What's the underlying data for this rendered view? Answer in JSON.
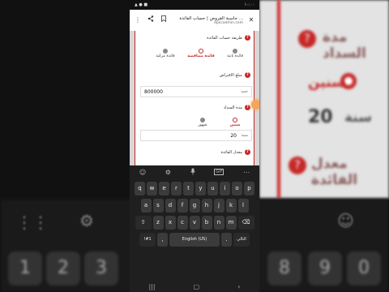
{
  "status": {
    "time": "١٠:٠٠",
    "icons": "▲ ● ■"
  },
  "browser": {
    "close": "✕",
    "title": "حاسبة القروض | حساب الفائدة ...",
    "url": "epiicadmin.com",
    "share_icon": "share-icon",
    "bookmark_icon": "bookmark-icon",
    "menu": "⋮"
  },
  "form": {
    "method_label": "طريقة حساب الفائدة",
    "methods": [
      {
        "label": "فائدة ثابتة",
        "state": "grey"
      },
      {
        "label": "فائدة متناقصة",
        "state": "selected"
      },
      {
        "label": "فائدة مركبة",
        "state": "grey"
      }
    ],
    "amount_label": "مبلغ الاقتراض",
    "amount_value": "800000",
    "amount_unit": "جنيه",
    "period_label": "مدة السداد",
    "period_options": [
      {
        "label": "سنين",
        "state": "selected"
      },
      {
        "label": "شهور",
        "state": "grey"
      }
    ],
    "period_value": "20",
    "period_unit": "سنة",
    "rate_label": "معدل الفائدة"
  },
  "keyboard": {
    "toolbar": [
      "☺",
      "⚙",
      "🎤",
      "GIF",
      "⋯"
    ],
    "row1": [
      "q",
      "w",
      "e",
      "r",
      "t",
      "y",
      "u",
      "i",
      "o",
      "p"
    ],
    "row2": [
      "a",
      "s",
      "d",
      "f",
      "g",
      "h",
      "j",
      "k",
      "l"
    ],
    "row3": [
      "z",
      "x",
      "c",
      "v",
      "b",
      "n",
      "m"
    ],
    "shift": "⇧",
    "backspace": "⌫",
    "symbols": "!#1",
    "comma": ",",
    "space": "English (US)",
    "period": ".",
    "enter": "التالي"
  },
  "navbar": {
    "recents": "|||",
    "home": "▢",
    "back": "‹"
  },
  "background": {
    "title1": "مدة السداد",
    "selected_option": "سنين",
    "value": "20",
    "unit": "سنة",
    "title2": "معدل الفائدة",
    "digits": [
      "1",
      "2",
      "3",
      "8",
      "9",
      "0"
    ]
  }
}
